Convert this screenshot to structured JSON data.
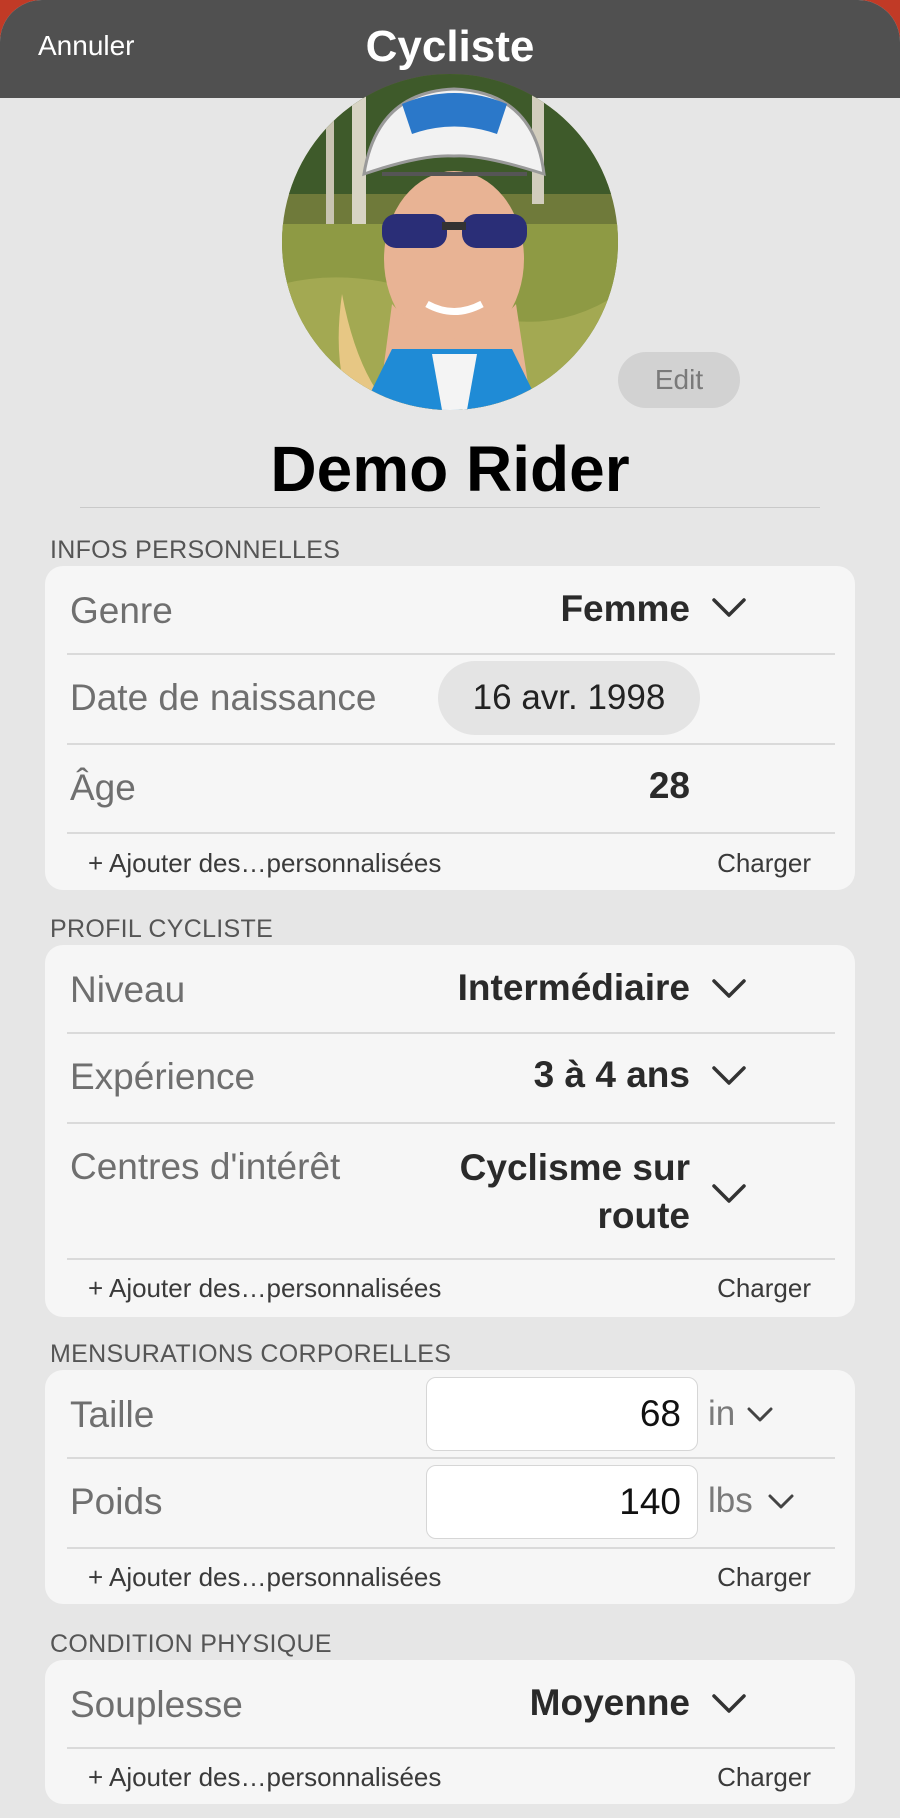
{
  "nav": {
    "cancel_label": "Annuler",
    "title": "Cycliste"
  },
  "profile": {
    "edit_label": "Edit",
    "name": "Demo Rider"
  },
  "sections": {
    "personal": {
      "title": "INFOS PERSONNELLES",
      "gender_label": "Genre",
      "gender_value": "Femme",
      "birth_label": "Date de naissance",
      "birth_value": "16 avr. 1998",
      "age_label": "Âge",
      "age_value": "28",
      "add_label": "+ Ajouter des…personnalisées",
      "load_label": "Charger"
    },
    "cycling": {
      "title": "PROFIL CYCLISTE",
      "level_label": "Niveau",
      "level_value": "Intermédiaire",
      "experience_label": "Expérience",
      "experience_value": "3 à 4 ans",
      "interests_label": "Centres d'intérêt",
      "interests_value_line1": "Cyclisme sur",
      "interests_value_line2": "route",
      "add_label": "+ Ajouter des…personnalisées",
      "load_label": "Charger"
    },
    "body": {
      "title": "MENSURATIONS CORPORELLES",
      "height_label": "Taille",
      "height_value": "68",
      "height_unit": "in",
      "weight_label": "Poids",
      "weight_value": "140",
      "weight_unit": "lbs",
      "add_label": "+ Ajouter des…personnalisées",
      "load_label": "Charger"
    },
    "fitness": {
      "title": "CONDITION PHYSIQUE",
      "flex_label": "Souplesse",
      "flex_value": "Moyenne",
      "add_label": "+ Ajouter des…personnalisées",
      "load_label": "Charger"
    }
  },
  "colors": {
    "accent_bg": "#c13a26",
    "nav_bg": "#505050",
    "card_bg": "#f6f6f6",
    "page_bg": "#e6e6e6"
  }
}
